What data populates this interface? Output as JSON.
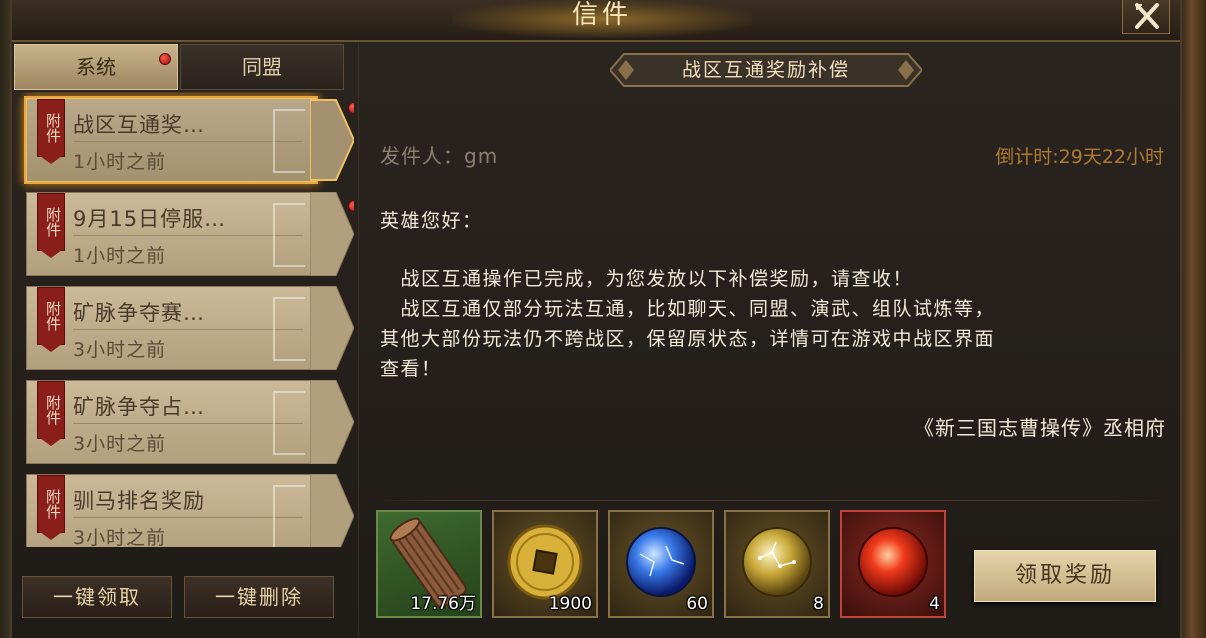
{
  "window": {
    "title": "信件"
  },
  "tabs": [
    {
      "label": "系统",
      "active": true,
      "has_notification": true
    },
    {
      "label": "同盟",
      "active": false,
      "has_notification": false
    }
  ],
  "mails": [
    {
      "tag": "附件",
      "subject": "战区互通奖…",
      "time": "1小时之前",
      "unread": true,
      "selected": true
    },
    {
      "tag": "附件",
      "subject": "9月15日停服…",
      "time": "1小时之前",
      "unread": true,
      "selected": false
    },
    {
      "tag": "附件",
      "subject": "矿脉争夺赛…",
      "time": "3小时之前",
      "unread": false,
      "selected": false
    },
    {
      "tag": "附件",
      "subject": "矿脉争夺占…",
      "time": "3小时之前",
      "unread": false,
      "selected": false
    },
    {
      "tag": "附件",
      "subject": "驯马排名奖励",
      "time": "3小时之前",
      "unread": false,
      "selected": false
    }
  ],
  "list_actions": {
    "claim_all": "一键领取",
    "delete_all": "一键删除"
  },
  "detail": {
    "subject": "战区互通奖励补偿",
    "sender": "发件人：gm",
    "countdown": "倒计时:29天22小时",
    "greeting": "英雄您好：",
    "paragraphs": [
      "　战区互通操作已完成，为您发放以下补偿奖励，请查收！",
      "　战区互通仅部分玩法互通，比如聊天、同盟、演武、组队试炼等，",
      "其他大部份玩法仍不跨战区，保留原状态，详情可在游戏中战区界面",
      "查看！"
    ],
    "signature": "《新三国志曹操传》丞相府"
  },
  "rewards": [
    {
      "icon": "bamboo-scroll-icon",
      "quantity": "17.76万",
      "quality": "green"
    },
    {
      "icon": "gold-coin-icon",
      "quantity": "1900",
      "quality": "gold"
    },
    {
      "icon": "blue-orb-icon",
      "quantity": "60",
      "quality": "gold"
    },
    {
      "icon": "yellow-orb-icon",
      "quantity": "8",
      "quality": "gold"
    },
    {
      "icon": "red-orb-icon",
      "quantity": "4",
      "quality": "red"
    }
  ],
  "claim_button": "领取奖励",
  "colors": {
    "accent": "#e8a83a",
    "countdown": "#b07a30",
    "notification": "#c02020"
  }
}
